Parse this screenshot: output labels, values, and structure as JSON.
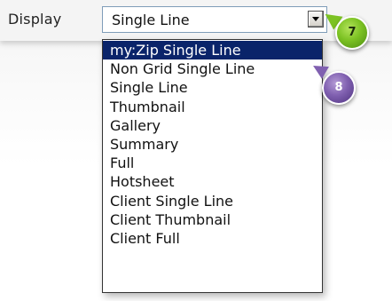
{
  "field": {
    "label": "Display",
    "selected_value": "Single Line"
  },
  "dropdown": {
    "items": [
      "my:Zip Single Line",
      "Non Grid Single Line",
      "Single Line",
      "Thumbnail",
      "Gallery",
      "Summary",
      "Full",
      "Hotsheet",
      "Client Single Line",
      "Client Thumbnail",
      "Client Full"
    ],
    "highlighted_index": 0
  },
  "callouts": {
    "first": "7",
    "second": "8"
  },
  "colors": {
    "highlight": "#0a246a",
    "callout_7": "#7cc223",
    "callout_8": "#8060b0"
  }
}
